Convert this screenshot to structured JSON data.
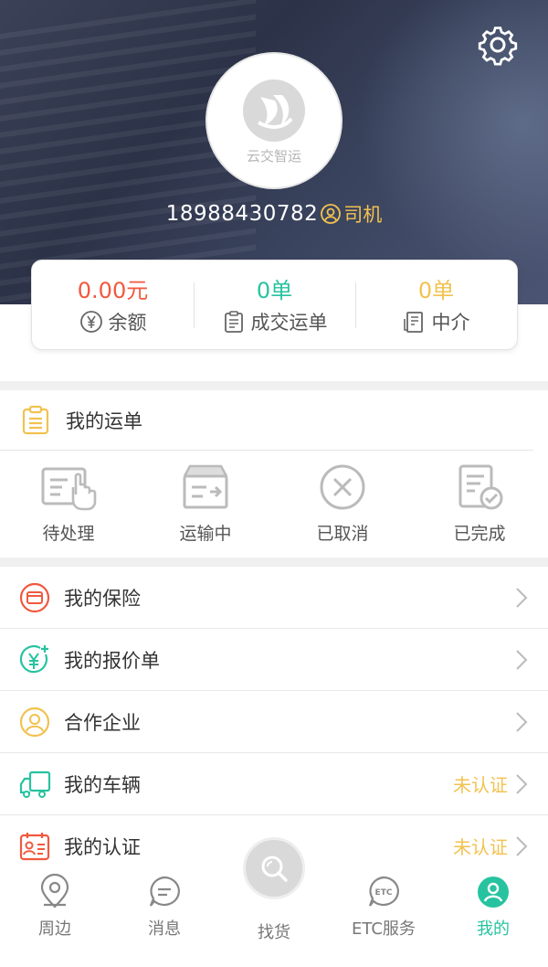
{
  "header": {
    "logo_text": "云交智运",
    "phone": "18988430782",
    "role": "司机"
  },
  "stats": [
    {
      "value": "0.00元",
      "label": "余额",
      "color": "#f2583e",
      "icon": "yen-circle-icon"
    },
    {
      "value": "0单",
      "label": "成交运单",
      "color": "#27c3a0",
      "icon": "clipboard-icon"
    },
    {
      "value": "0单",
      "label": "中介",
      "color": "#f2c24f",
      "icon": "receipt-icon"
    }
  ],
  "orders": {
    "title": "我的运单",
    "items": [
      {
        "label": "待处理",
        "icon": "pending-icon"
      },
      {
        "label": "运输中",
        "icon": "in-transit-icon"
      },
      {
        "label": "已取消",
        "icon": "cancelled-icon"
      },
      {
        "label": "已完成",
        "icon": "completed-icon"
      }
    ]
  },
  "menu": [
    {
      "label": "我的保险",
      "status": "",
      "icon": "insurance-icon",
      "color": "#f2583e"
    },
    {
      "label": "我的报价单",
      "status": "",
      "icon": "quote-icon",
      "color": "#27c3a0"
    },
    {
      "label": "合作企业",
      "status": "",
      "icon": "partner-icon",
      "color": "#f2c24f"
    },
    {
      "label": "我的车辆",
      "status": "未认证",
      "icon": "truck-icon",
      "color": "#27c3a0"
    },
    {
      "label": "我的认证",
      "status": "未认证",
      "icon": "id-card-icon",
      "color": "#f2583e"
    }
  ],
  "tabbar": [
    {
      "label": "周边",
      "icon": "location-icon"
    },
    {
      "label": "消息",
      "icon": "message-icon"
    },
    {
      "label": "找货",
      "icon": "search-icon"
    },
    {
      "label": "ETC服务",
      "icon": "etc-icon"
    },
    {
      "label": "我的",
      "icon": "profile-icon",
      "active": true
    }
  ],
  "colors": {
    "accent": "#27c3a0",
    "warning": "#f2c24f",
    "danger": "#f2583e"
  }
}
